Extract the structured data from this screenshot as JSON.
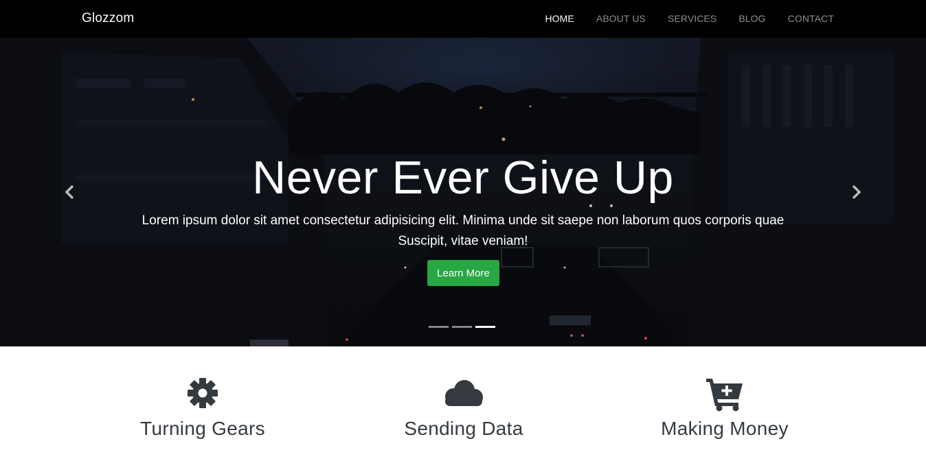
{
  "brand": "Glozzom",
  "nav": {
    "items": [
      {
        "label": "HOME",
        "active": true
      },
      {
        "label": "ABOUT US",
        "active": false
      },
      {
        "label": "SERVICES",
        "active": false
      },
      {
        "label": "BLOG",
        "active": false
      },
      {
        "label": "CONTACT",
        "active": false
      }
    ]
  },
  "hero": {
    "title": "Never Ever Give Up",
    "text": "Lorem ipsum dolor sit amet consectetur adipisicing elit. Minima unde sit saepe non laborum quos corporis quae Suscipit, vitae veniam!",
    "button_label": "Learn More",
    "prev_icon": "chevron-left-icon",
    "next_icon": "chevron-right-icon",
    "slides_count": 3,
    "active_slide": 3
  },
  "features": [
    {
      "icon": "gear-icon",
      "label": "Turning Gears"
    },
    {
      "icon": "cloud-icon",
      "label": "Sending Data"
    },
    {
      "icon": "cart-plus-icon",
      "label": "Making Money"
    }
  ],
  "colors": {
    "navbar_bg": "#000000",
    "button_bg": "#28a745",
    "icon_color": "#343a40"
  }
}
